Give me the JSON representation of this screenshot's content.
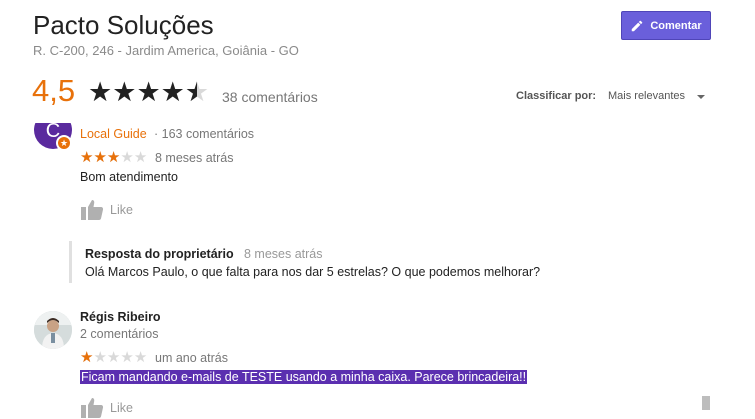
{
  "header": {
    "title": "Pacto Soluções",
    "address": "R. C-200, 246 - Jardim America, Goiânia - GO",
    "comment_button": "Comentar"
  },
  "summary": {
    "rating_text": "4,5",
    "rating_value": 4.5,
    "review_count": "38 comentários"
  },
  "sort": {
    "label": "Classificar por:",
    "value": "Mais relevantes"
  },
  "reviews": [
    {
      "avatar_initial": "C",
      "guide_label": "Local Guide",
      "comment_count": " · 163 comentários",
      "stars": 3,
      "time": "8 meses atrás",
      "text": "Bom atendimento",
      "like_label": "Like",
      "reply": {
        "title": "Resposta do proprietário",
        "time": "8 meses atrás",
        "text": "Olá Marcos Paulo, o que falta para nos dar 5 estrelas? O que podemos melhorar?"
      }
    },
    {
      "name": "Régis Ribeiro",
      "comment_count": "2 comentários",
      "stars": 1,
      "time": "um ano atrás",
      "text": "Ficam mandando e-mails de TESTE usando a minha caixa. Parece brincadeira!!",
      "like_label": "Like"
    }
  ],
  "colors": {
    "accent": "#e8710a",
    "button": "#6a5fdb",
    "selection": "#5b2fb0"
  },
  "icons": {
    "pencil": "pencil-icon",
    "thumbs_up": "thumbs-up-icon",
    "dropdown": "dropdown-arrow-icon"
  }
}
